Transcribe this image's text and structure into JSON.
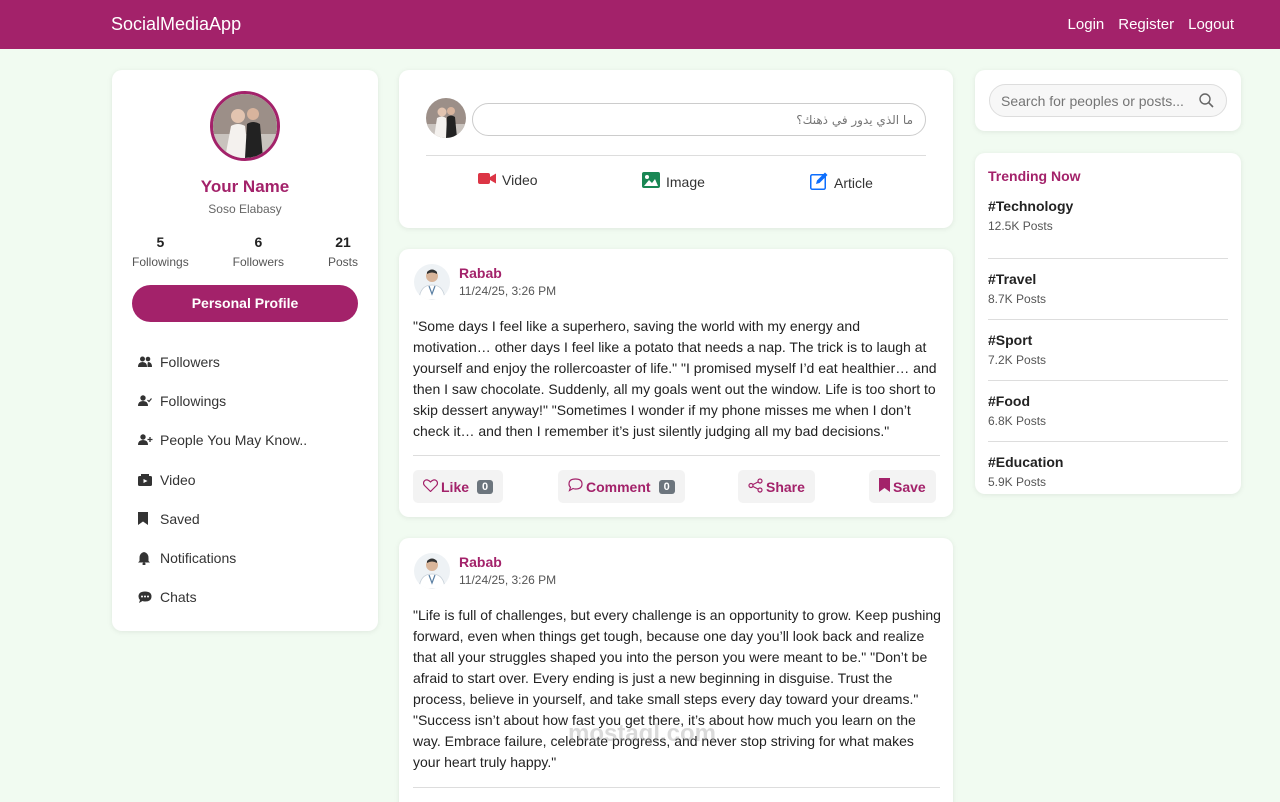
{
  "navbar": {
    "brand": "SocialMediaApp",
    "links": [
      "Login",
      "Register",
      "Logout"
    ]
  },
  "profile": {
    "name": "Your Name",
    "username": "Soso Elabasy",
    "stats": [
      {
        "value": "5",
        "label": "Followings"
      },
      {
        "value": "6",
        "label": "Followers"
      },
      {
        "value": "21",
        "label": "Posts"
      }
    ],
    "button_label": "Personal Profile",
    "menu": [
      {
        "label": "Followers",
        "icon": "users-icon"
      },
      {
        "label": "Followings",
        "icon": "user-check-icon"
      },
      {
        "label": "People You May Know..",
        "icon": "user-plus-icon"
      },
      {
        "label": "Video",
        "icon": "video-icon"
      },
      {
        "label": "Saved",
        "icon": "bookmark-icon"
      },
      {
        "label": "Notifications",
        "icon": "bell-icon"
      },
      {
        "label": "Chats",
        "icon": "chat-icon"
      }
    ]
  },
  "composer": {
    "placeholder": "ما الذي يدور في ذهنك؟",
    "actions": [
      {
        "label": "Video",
        "icon": "video-camera-icon",
        "color": "#dc3545"
      },
      {
        "label": "Image",
        "icon": "image-icon",
        "color": "#198754"
      },
      {
        "label": "Article",
        "icon": "pencil-square-icon",
        "color": "#0d6efd"
      }
    ]
  },
  "posts": [
    {
      "author": "Rabab",
      "time": "11/24/25, 3:26 PM",
      "text": "\"Some days I feel like a superhero, saving the world with my energy and motivation… other days I feel like a potato that needs a nap. The trick is to laugh at yourself and enjoy the rollercoaster of life.\" \"I promised myself I’d eat healthier… and then I saw chocolate. Suddenly, all my goals went out the window. Life is too short to skip dessert anyway!\" \"Sometimes I wonder if my phone misses me when I don’t check it… and then I remember it’s just silently judging all my bad decisions.\"",
      "like_label": "Like",
      "like_count": "0",
      "comment_label": "Comment",
      "comment_count": "0",
      "share_label": "Share",
      "save_label": "Save"
    },
    {
      "author": "Rabab",
      "time": "11/24/25, 3:26 PM",
      "text": "\"Life is full of challenges, but every challenge is an opportunity to grow. Keep pushing forward, even when things get tough, because one day you’ll look back and realize that all your struggles shaped you into the person you were meant to be.\" \"Don’t be afraid to start over. Every ending is just a new beginning in disguise. Trust the process, believe in yourself, and take small steps every day toward your dreams.\" \"Success isn’t about how fast you get there, it’s about how much you learn on the way. Embrace failure, celebrate progress, and never stop striving for what makes your heart truly happy.\""
    }
  ],
  "search": {
    "placeholder": "Search for peoples or posts..."
  },
  "trending": {
    "title": "Trending Now",
    "items": [
      {
        "tag": "#Technology",
        "count": "12.5K Posts"
      },
      {
        "tag": "#Travel",
        "count": "8.7K Posts"
      },
      {
        "tag": "#Sport",
        "count": "7.2K Posts"
      },
      {
        "tag": "#Food",
        "count": "6.8K Posts"
      },
      {
        "tag": "#Education",
        "count": "5.9K Posts"
      }
    ]
  },
  "watermark": "mostaql.com",
  "colors": {
    "accent": "#a3226a",
    "background": "#f1fbf1"
  }
}
